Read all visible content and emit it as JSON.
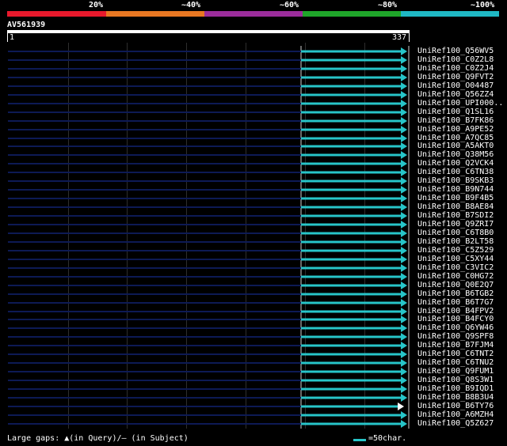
{
  "identity_scale": {
    "labels": [
      "20%",
      "~40%",
      "~60%",
      "~80%",
      "~100%"
    ],
    "colors": [
      "#e8192c",
      "#e87722",
      "#9b2d9b",
      "#1fa52a",
      "#1fb8c4"
    ]
  },
  "query": {
    "id": "AV561939",
    "start": "1",
    "end": "337"
  },
  "hit_colors": {
    "aligned": "#27c5c9",
    "unaligned": "#0d1a55"
  },
  "hits": [
    {
      "label": "UniRef100_Q56WV5",
      "arrow": "full"
    },
    {
      "label": "UniRef100_C0Z2L8",
      "arrow": "full"
    },
    {
      "label": "UniRef100_C0Z2J4",
      "arrow": "full"
    },
    {
      "label": "UniRef100_Q9FVT2",
      "arrow": "full"
    },
    {
      "label": "UniRef100_O04487",
      "arrow": "full"
    },
    {
      "label": "UniRef100_Q56ZZ4",
      "arrow": "full"
    },
    {
      "label": "UniRef100_UPI000..",
      "arrow": "full"
    },
    {
      "label": "UniRef100_Q1SL16",
      "arrow": "full"
    },
    {
      "label": "UniRef100_B7FK86",
      "arrow": "full"
    },
    {
      "label": "UniRef100_A9PE52",
      "arrow": "full"
    },
    {
      "label": "UniRef100_A7QC85",
      "arrow": "full"
    },
    {
      "label": "UniRef100_A5AKT0",
      "arrow": "full"
    },
    {
      "label": "UniRef100_Q38M56",
      "arrow": "full"
    },
    {
      "label": "UniRef100_Q2VCK4",
      "arrow": "full"
    },
    {
      "label": "UniRef100_C6TN38",
      "arrow": "full"
    },
    {
      "label": "UniRef100_B9SKB3",
      "arrow": "full"
    },
    {
      "label": "UniRef100_B9N744",
      "arrow": "full"
    },
    {
      "label": "UniRef100_B9F4B5",
      "arrow": "full"
    },
    {
      "label": "UniRef100_B8AE84",
      "arrow": "full"
    },
    {
      "label": "UniRef100_B7SDI2",
      "arrow": "full"
    },
    {
      "label": "UniRef100_Q9ZRI7",
      "arrow": "full"
    },
    {
      "label": "UniRef100_C6T8B0",
      "arrow": "full"
    },
    {
      "label": "UniRef100_B2LT58",
      "arrow": "full"
    },
    {
      "label": "UniRef100_C5Z529",
      "arrow": "full"
    },
    {
      "label": "UniRef100_C5XY44",
      "arrow": "full"
    },
    {
      "label": "UniRef100_C3VIC2",
      "arrow": "full"
    },
    {
      "label": "UniRef100_C0HG72",
      "arrow": "full"
    },
    {
      "label": "UniRef100_Q0E2Q7",
      "arrow": "full"
    },
    {
      "label": "UniRef100_B6TGB2",
      "arrow": "full"
    },
    {
      "label": "UniRef100_B6T7G7",
      "arrow": "full"
    },
    {
      "label": "UniRef100_B4FPV2",
      "arrow": "full"
    },
    {
      "label": "UniRef100_B4FCY0",
      "arrow": "full"
    },
    {
      "label": "UniRef100_Q6YW46",
      "arrow": "full"
    },
    {
      "label": "UniRef100_Q9SPF8",
      "arrow": "full"
    },
    {
      "label": "UniRef100_B7FJM4",
      "arrow": "full"
    },
    {
      "label": "UniRef100_C6TNT2",
      "arrow": "full"
    },
    {
      "label": "UniRef100_C6TNU2",
      "arrow": "full"
    },
    {
      "label": "UniRef100_Q9FUM1",
      "arrow": "full"
    },
    {
      "label": "UniRef100_Q8S3W1",
      "arrow": "full"
    },
    {
      "label": "UniRef100_B9IQD1",
      "arrow": "full"
    },
    {
      "label": "UniRef100_B8B3U4",
      "arrow": "full"
    },
    {
      "label": "UniRef100_B6TY76",
      "arrow": "short"
    },
    {
      "label": "UniRef100_A6MZH4",
      "arrow": "full"
    },
    {
      "label": "UniRef100_Q5Z627",
      "arrow": "full"
    }
  ],
  "footer": {
    "legend": "Large gaps: ▲(in Query)/– (in Subject)",
    "scale_label": "=50char."
  }
}
